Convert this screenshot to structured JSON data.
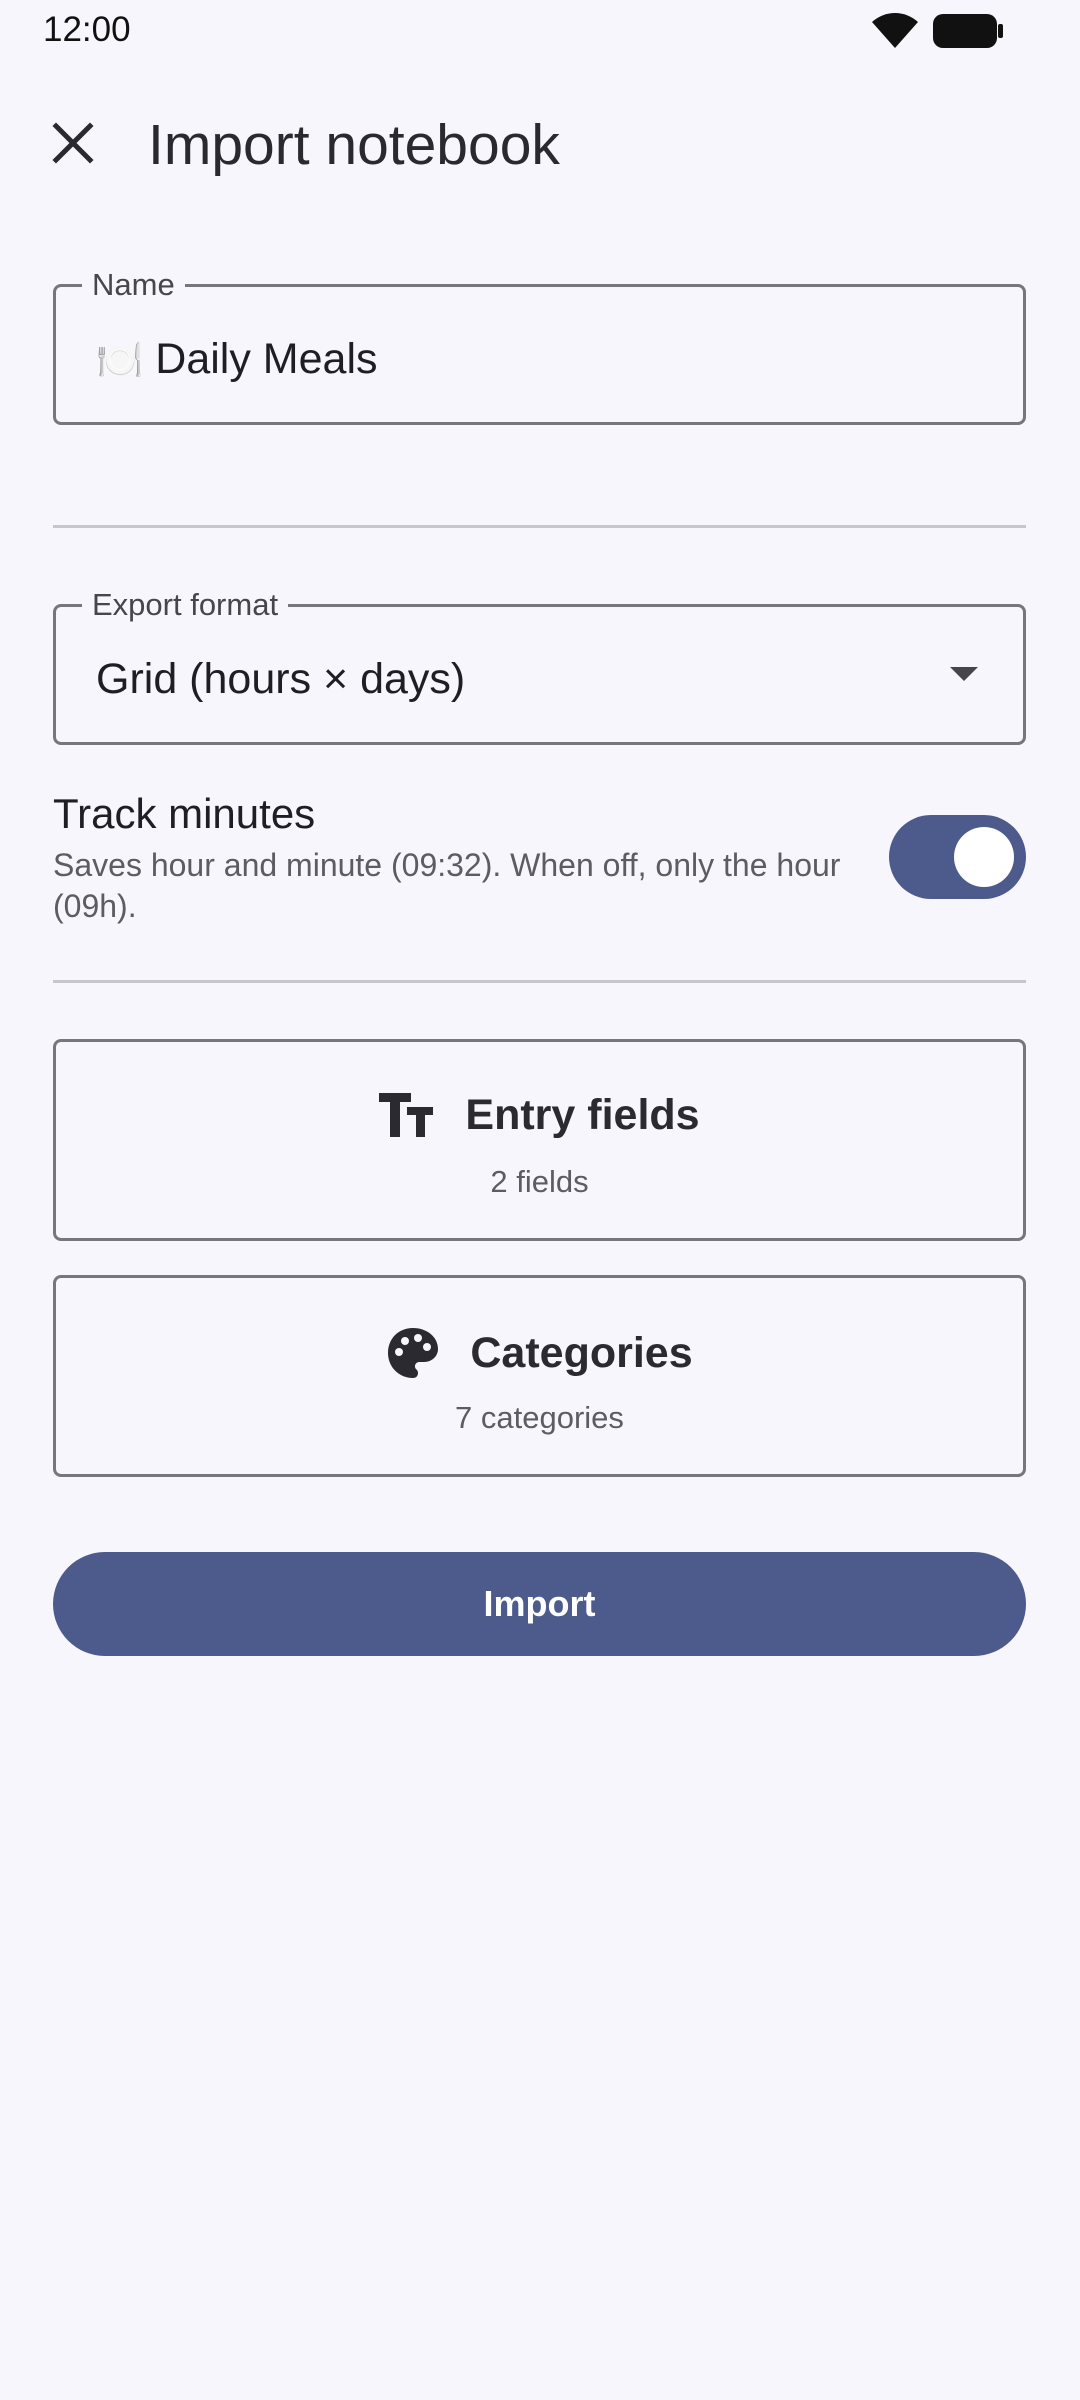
{
  "status_bar": {
    "time": "12:00",
    "icons": [
      "wifi-icon",
      "battery-icon"
    ]
  },
  "top_bar": {
    "close_icon": "close-icon",
    "title": "Import notebook"
  },
  "name_field": {
    "label": "Name",
    "emoji": "🍽️",
    "value": "Daily Meals"
  },
  "format_field": {
    "label": "Export format",
    "value": "Grid (hours × days)",
    "icon": "dropdown-arrow-icon"
  },
  "track_minutes": {
    "title": "Track minutes",
    "description": "Saves hour and minute (09:32). When off, only the hour (09h).",
    "enabled": true
  },
  "entry_fields_card": {
    "icon": "text-fields-icon",
    "title": "Entry fields",
    "subtitle": "2 fields"
  },
  "categories_card": {
    "icon": "palette-icon",
    "title": "Categories",
    "subtitle": "7 categories"
  },
  "import_button": {
    "label": "Import"
  },
  "colors": {
    "background": "#f8f6fd",
    "primary": "#4c5b8b",
    "outline": "#77767c",
    "on_primary": "#ffffff"
  }
}
